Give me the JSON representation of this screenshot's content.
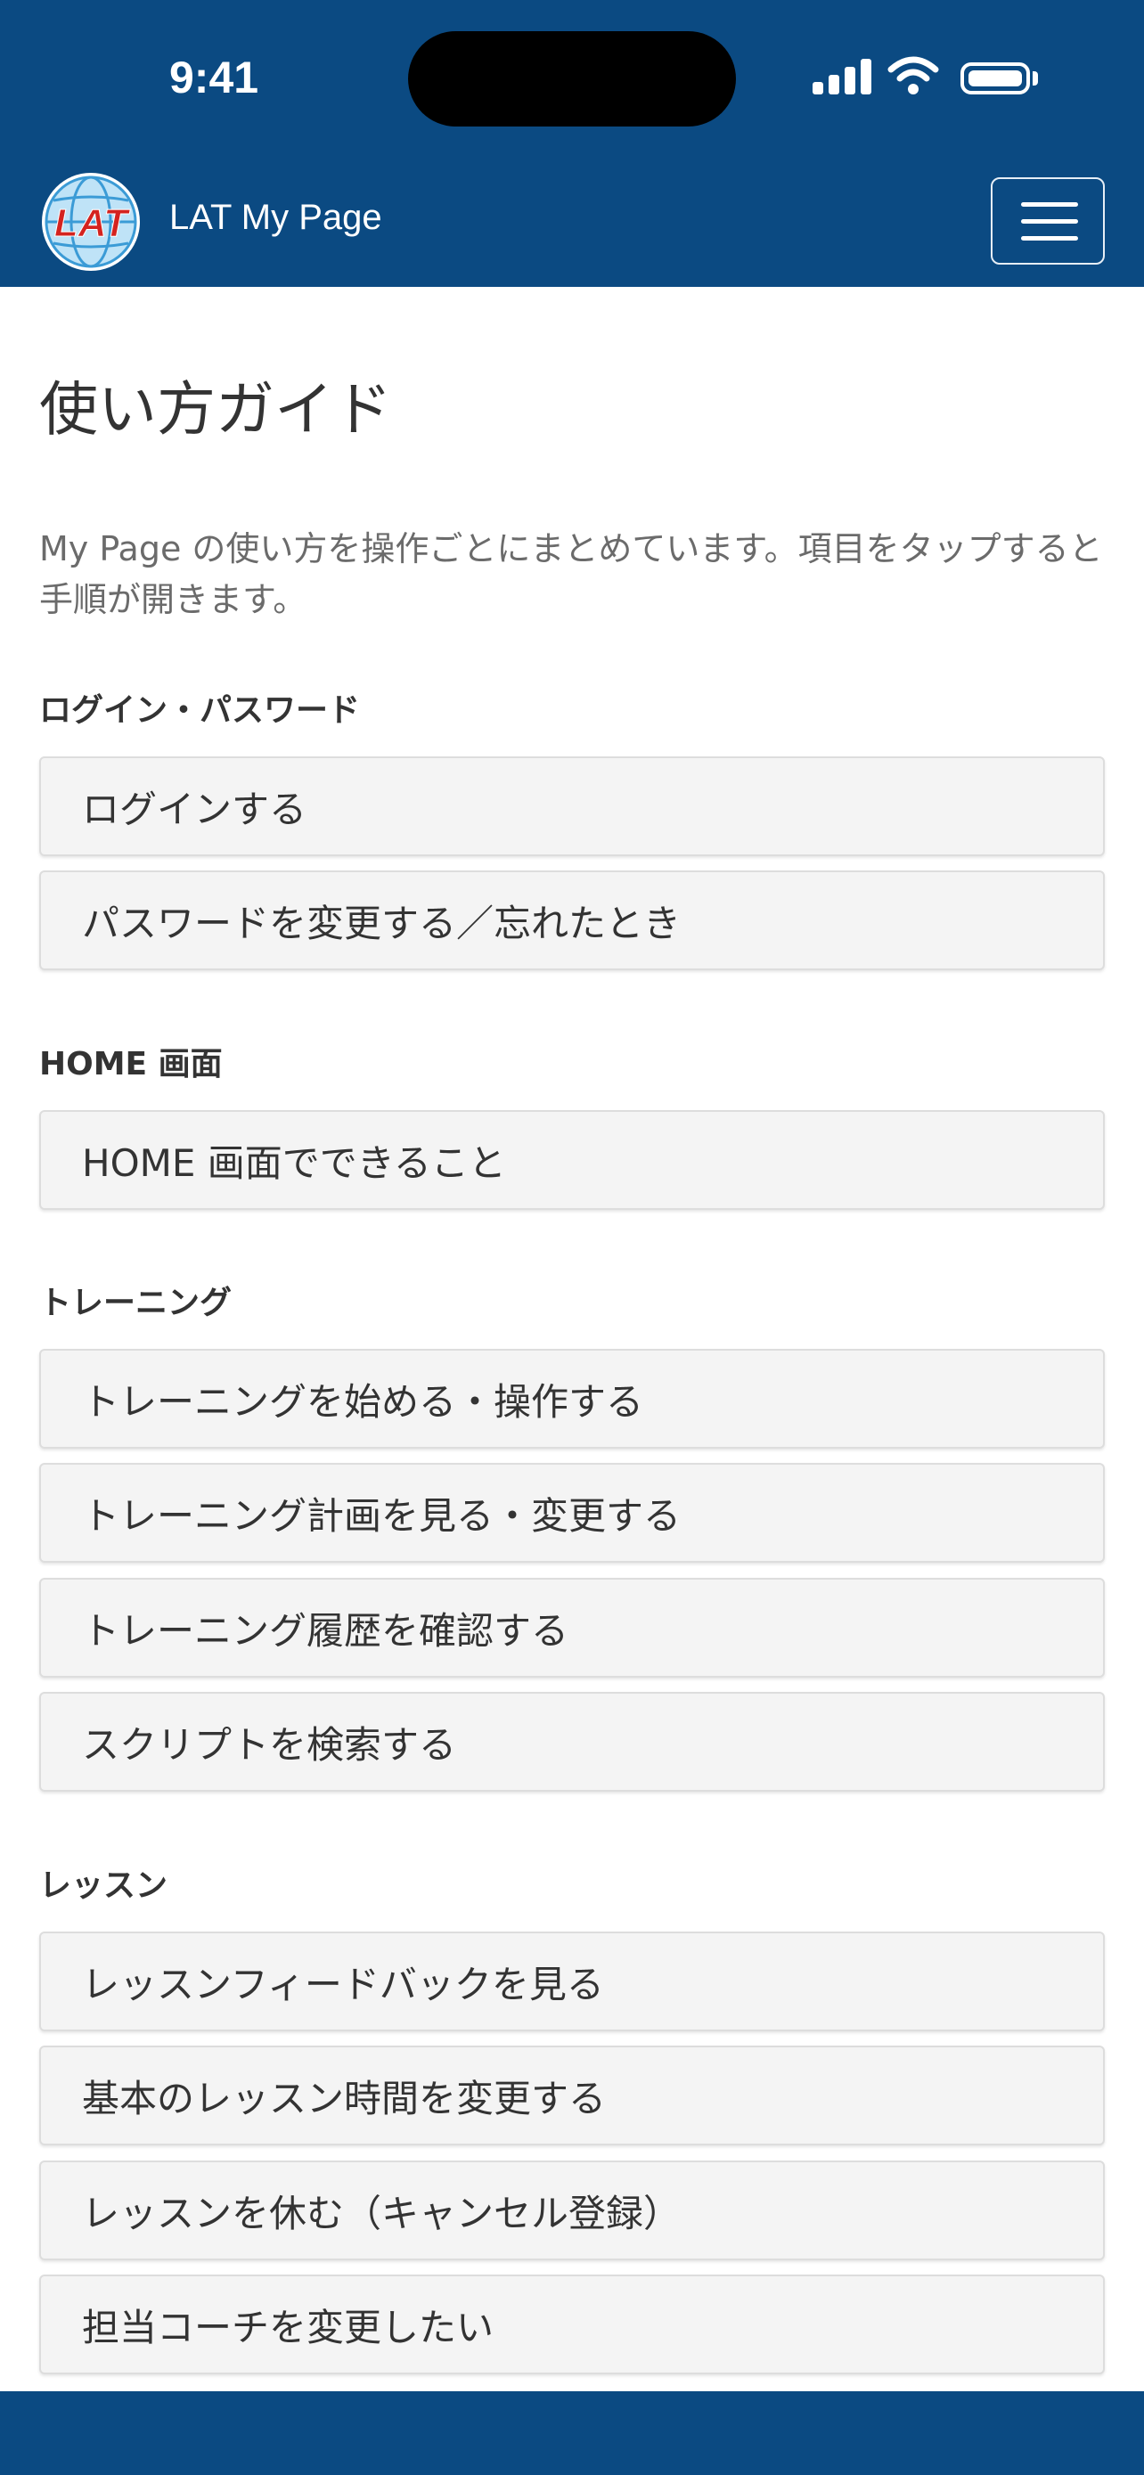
{
  "status_bar": {
    "time": "9:41"
  },
  "navbar": {
    "brand": "LAT My Page",
    "logo_text": "LAT",
    "menu_icon": "hamburger-menu-icon"
  },
  "page": {
    "title": "使い方ガイド",
    "intro": "My Page の使い方を操作ごとにまとめています。項目をタップすると手順が開きます。"
  },
  "sections": [
    {
      "heading": "ログイン・パスワード",
      "items": [
        "ログインする",
        "パスワードを変更する／忘れたとき"
      ]
    },
    {
      "heading": "HOME 画面",
      "items": [
        "HOME 画面でできること"
      ]
    },
    {
      "heading": "トレーニング",
      "items": [
        "トレーニングを始める・操作する",
        "トレーニング計画を見る・変更する",
        "トレーニング履歴を確認する",
        "スクリプトを検索する"
      ]
    },
    {
      "heading": "レッスン",
      "items": [
        "レッスンフィードバックを見る",
        "基本のレッスン時間を変更する",
        "レッスンを休む（キャンセル登録）",
        "担当コーチを変更したい"
      ]
    }
  ],
  "colors": {
    "primary": "#0b4a82",
    "item_bg": "#f4f4f4",
    "item_border": "#dddddd",
    "text": "#333333",
    "muted_text": "#6b6b6b"
  }
}
